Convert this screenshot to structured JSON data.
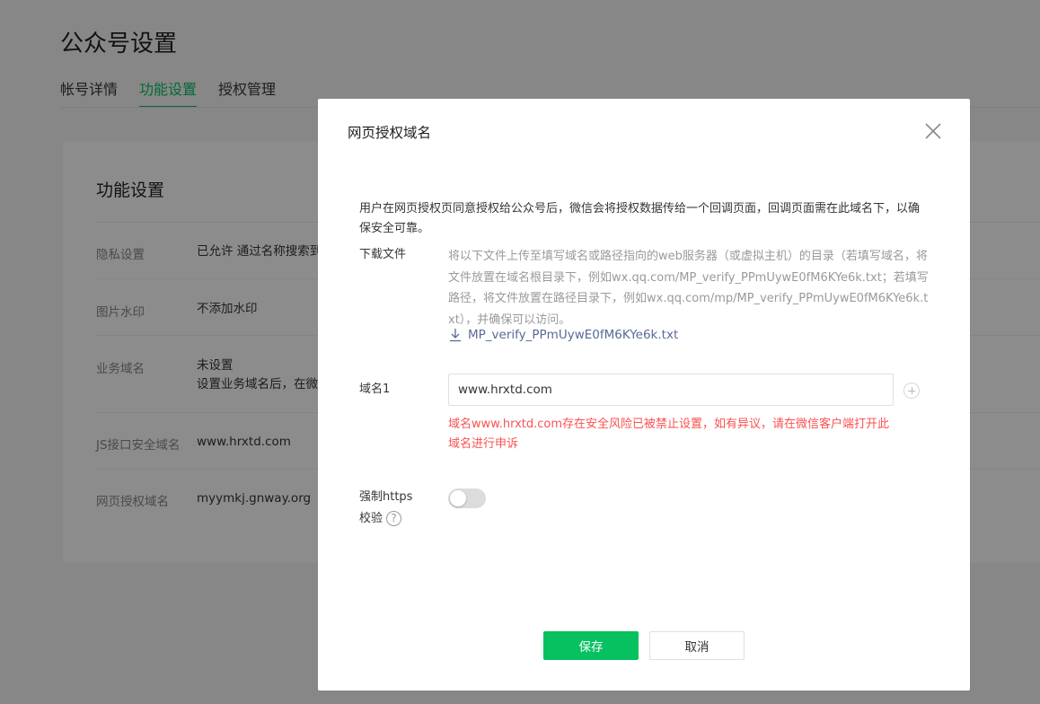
{
  "page": {
    "title": "公众号设置",
    "tabs": [
      {
        "label": "帐号详情"
      },
      {
        "label": "功能设置"
      },
      {
        "label": "授权管理"
      }
    ]
  },
  "card": {
    "title": "功能设置",
    "rows": [
      {
        "label": "隐私设置",
        "value": "已允许 通过名称搜索到"
      },
      {
        "label": "图片水印",
        "value": "不添加水印"
      },
      {
        "label": "业务域名",
        "value": "未设置",
        "value2": "设置业务域名后，在微"
      },
      {
        "label": "JS接口安全域名",
        "value": "www.hrxtd.com"
      },
      {
        "label": "网页授权域名",
        "value": "myymkj.gnway.org"
      }
    ]
  },
  "dialog": {
    "title": "网页授权域名",
    "description": "用户在网页授权页同意授权给公众号后，微信会将授权数据传给一个回调页面，回调页面需在此域名下，以确保安全可靠。",
    "download_label": "下载文件",
    "download_text": "将以下文件上传至填写域名或路径指向的web服务器（或虚拟主机）的目录（若填写域名，将文件放置在域名根目录下，例如wx.qq.com/MP_verify_PPmUywE0fM6KYe6k.txt；若填写路径，将文件放置在路径目录下，例如wx.qq.com/mp/MP_verify_PPmUywE0fM6KYe6k.txt），并确保可以访问。",
    "download_file": "MP_verify_PPmUywE0fM6KYe6k.txt",
    "domain_label": "域名1",
    "domain_value": "www.hrxtd.com",
    "error_text": "域名www.hrxtd.com存在安全风险已被禁止设置，如有异议，请在微信客户端打开此域名进行申诉",
    "https_label_line1": "强制https",
    "https_label_line2": "校验",
    "https_enabled": false,
    "help_glyph": "?",
    "save_label": "保存",
    "cancel_label": "取消"
  },
  "colors": {
    "accent": "#07c160",
    "error": "#fa5151",
    "link": "#576b95"
  },
  "icons": [
    "close-icon",
    "download-icon",
    "plus-icon",
    "help-icon"
  ]
}
